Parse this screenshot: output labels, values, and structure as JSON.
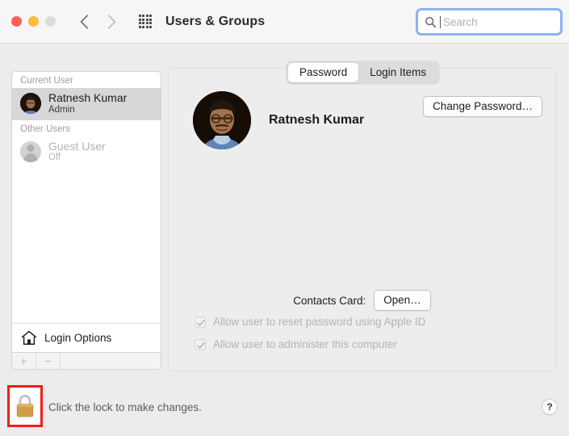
{
  "window": {
    "title": "Users & Groups",
    "traffic_lights": [
      "close",
      "minimize",
      "zoom"
    ],
    "back_icon": "chevron-left-icon",
    "forward_icon": "chevron-right-icon",
    "grid_icon": "show-all-grid-icon"
  },
  "search": {
    "placeholder": "Search",
    "value": "",
    "icon": "search-icon"
  },
  "sidebar": {
    "groups": [
      {
        "header": "Current User",
        "users": [
          {
            "name": "Ratnesh Kumar",
            "role": "Admin",
            "selected": true,
            "avatar": "photo-avatar"
          }
        ]
      },
      {
        "header": "Other Users",
        "users": [
          {
            "name": "Guest User",
            "role": "Off",
            "selected": false,
            "avatar": "person-placeholder-icon"
          }
        ]
      }
    ],
    "login_options": {
      "label": "Login Options",
      "icon": "home-icon"
    },
    "toolbar": {
      "add_label": "+",
      "remove_label": "−"
    }
  },
  "main": {
    "tabs": [
      {
        "label": "Password",
        "active": true
      },
      {
        "label": "Login Items",
        "active": false
      }
    ],
    "profile": {
      "name": "Ratnesh Kumar",
      "avatar": "photo-avatar"
    },
    "change_password_label": "Change Password…",
    "contacts_card_label": "Contacts Card:",
    "open_label": "Open…",
    "checkboxes": [
      {
        "label": "Allow user to reset password using Apple ID",
        "checked": true,
        "enabled": false
      },
      {
        "label": "Allow user to administer this computer",
        "checked": true,
        "enabled": false
      }
    ]
  },
  "footer": {
    "lock_icon": "closed-padlock-icon",
    "lock_message": "Click the lock to make changes.",
    "help_label": "?"
  },
  "colors": {
    "accent_focus_ring": "#8fb2f0",
    "annotation_red": "#f01e15",
    "window_background": "#ececec",
    "titlebar_background": "#f6f6f6",
    "panel_background": "#ededed",
    "selected_row": "#d7d7d7",
    "disabled_text": "#b3b3b3",
    "lock_gold": "#dba74e"
  }
}
